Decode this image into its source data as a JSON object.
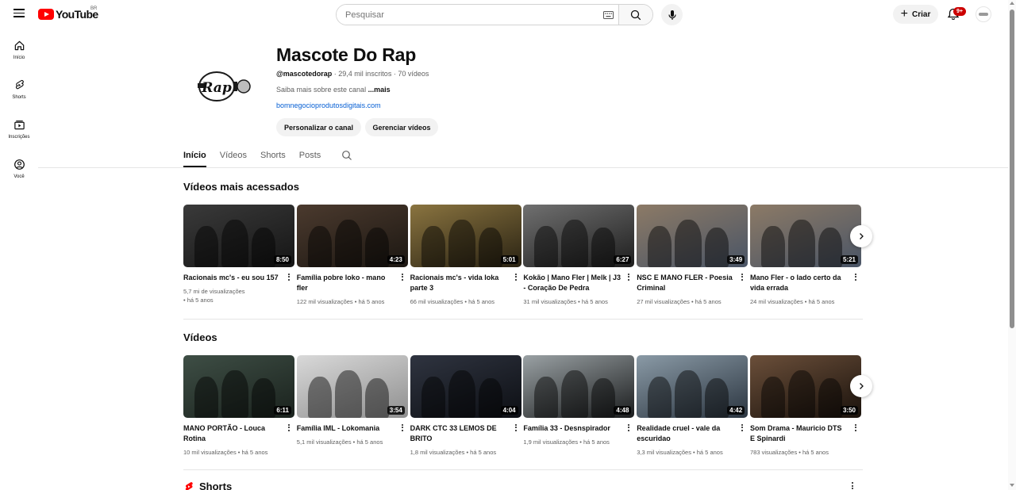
{
  "topbar": {
    "logo_text": "YouTube",
    "region": "BR",
    "search_placeholder": "Pesquisar",
    "create_label": "Criar",
    "notifications_count": "9+"
  },
  "sidebar": {
    "items": [
      {
        "label": "Início",
        "icon": "home-icon"
      },
      {
        "label": "Shorts",
        "icon": "shorts-icon"
      },
      {
        "label": "Inscrições",
        "icon": "subscriptions-icon"
      },
      {
        "label": "Você",
        "icon": "you-icon"
      }
    ]
  },
  "channel": {
    "avatar_text": "Rap",
    "name": "Mascote Do Rap",
    "handle": "@mascotedorap",
    "stats": " · 29,4 mil inscritos · 70 vídeos",
    "about": "Saiba mais sobre este canal ",
    "about_more": "...mais",
    "link": "bomnegocioprodutosdigitais.com",
    "customize_label": "Personalizar o canal",
    "manage_label": "Gerenciar vídeos"
  },
  "tabs": [
    {
      "label": "Início",
      "active": true
    },
    {
      "label": "Vídeos",
      "active": false
    },
    {
      "label": "Shorts",
      "active": false
    },
    {
      "label": "Posts",
      "active": false
    }
  ],
  "sections": {
    "popular": {
      "title": "Vídeos mais acessados",
      "videos": [
        {
          "title": "Racionais mc's - eu sou 157",
          "duration": "8:50",
          "meta_views": "5,7 mi de visualizações",
          "meta_age": "• há 5 anos",
          "bg": [
            "#3a3a3a",
            "#151515"
          ]
        },
        {
          "title": "Família pobre loko - mano fler",
          "duration": "4:23",
          "meta_views": "122 mil visualizações • há 5 anos",
          "meta_age": "",
          "bg": [
            "#4b3a2e",
            "#1c1712"
          ]
        },
        {
          "title": "Racionais mc's - vida loka parte 3",
          "duration": "5:01",
          "meta_views": "66 mil visualizações • há 5 anos",
          "meta_age": "",
          "bg": [
            "#8a7440",
            "#2a2313"
          ]
        },
        {
          "title": "Kokão | Mano Fler | Melk | J3 - Coração De Pedra",
          "duration": "6:27",
          "meta_views": "31 mil visualizações • há 5 anos",
          "meta_age": "",
          "bg": [
            "#707070",
            "#1e1e1e"
          ]
        },
        {
          "title": "NSC E MANO FLER - Poesia Criminal",
          "duration": "3:49",
          "meta_views": "27 mil visualizações • há 5 anos",
          "meta_age": "",
          "bg": [
            "#8c7a66",
            "#4a5566"
          ]
        },
        {
          "title": "Mano Fler - o lado certo da vida errada",
          "duration": "5:21",
          "meta_views": "24 mil visualizações • há 5 anos",
          "meta_age": "",
          "bg": [
            "#8c7a66",
            "#4a5566"
          ]
        }
      ]
    },
    "videos": {
      "title": "Vídeos",
      "videos": [
        {
          "title": "MANO PORTÃO - Louca Rotina",
          "duration": "6:11",
          "meta_views": "10 mil visualizações • há 5 anos",
          "meta_age": "",
          "bg": [
            "#3e4e45",
            "#1a221d"
          ]
        },
        {
          "title": "Família IML - Lokomania",
          "duration": "3:54",
          "meta_views": "5,1 mil visualizações • há 5 anos",
          "meta_age": "",
          "bg": [
            "#d9d9d9",
            "#8f8f8f"
          ]
        },
        {
          "title": "DARK CTC 33 LEMOS DE BRITO",
          "duration": "4:04",
          "meta_views": "1,8 mil visualizações • há 5 anos",
          "meta_age": "",
          "bg": [
            "#2f3440",
            "#0d0f14"
          ]
        },
        {
          "title": "Família 33 - Desnspirador",
          "duration": "4:48",
          "meta_views": "1,9 mil visualizações • há 5 anos",
          "meta_age": "",
          "bg": [
            "#9aa1a4",
            "#1a1c1d"
          ]
        },
        {
          "title": "Realidade cruel - vale da escuridao",
          "duration": "4:42",
          "meta_views": "3,3 mil visualizações • há 5 anos",
          "meta_age": "",
          "bg": [
            "#8a9aa6",
            "#2b3540"
          ]
        },
        {
          "title": "Som Drama - Mauricio DTS E Spinardi",
          "duration": "3:50",
          "meta_views": "783 visualizações • há 5 anos",
          "meta_age": "",
          "bg": [
            "#6b4f3a",
            "#1a120c"
          ]
        }
      ]
    },
    "shorts": {
      "title": "Shorts"
    }
  },
  "colors": {
    "brand": "#ff0000",
    "badge": "#cc0000",
    "link": "#065fd4",
    "text_secondary": "#606060"
  }
}
